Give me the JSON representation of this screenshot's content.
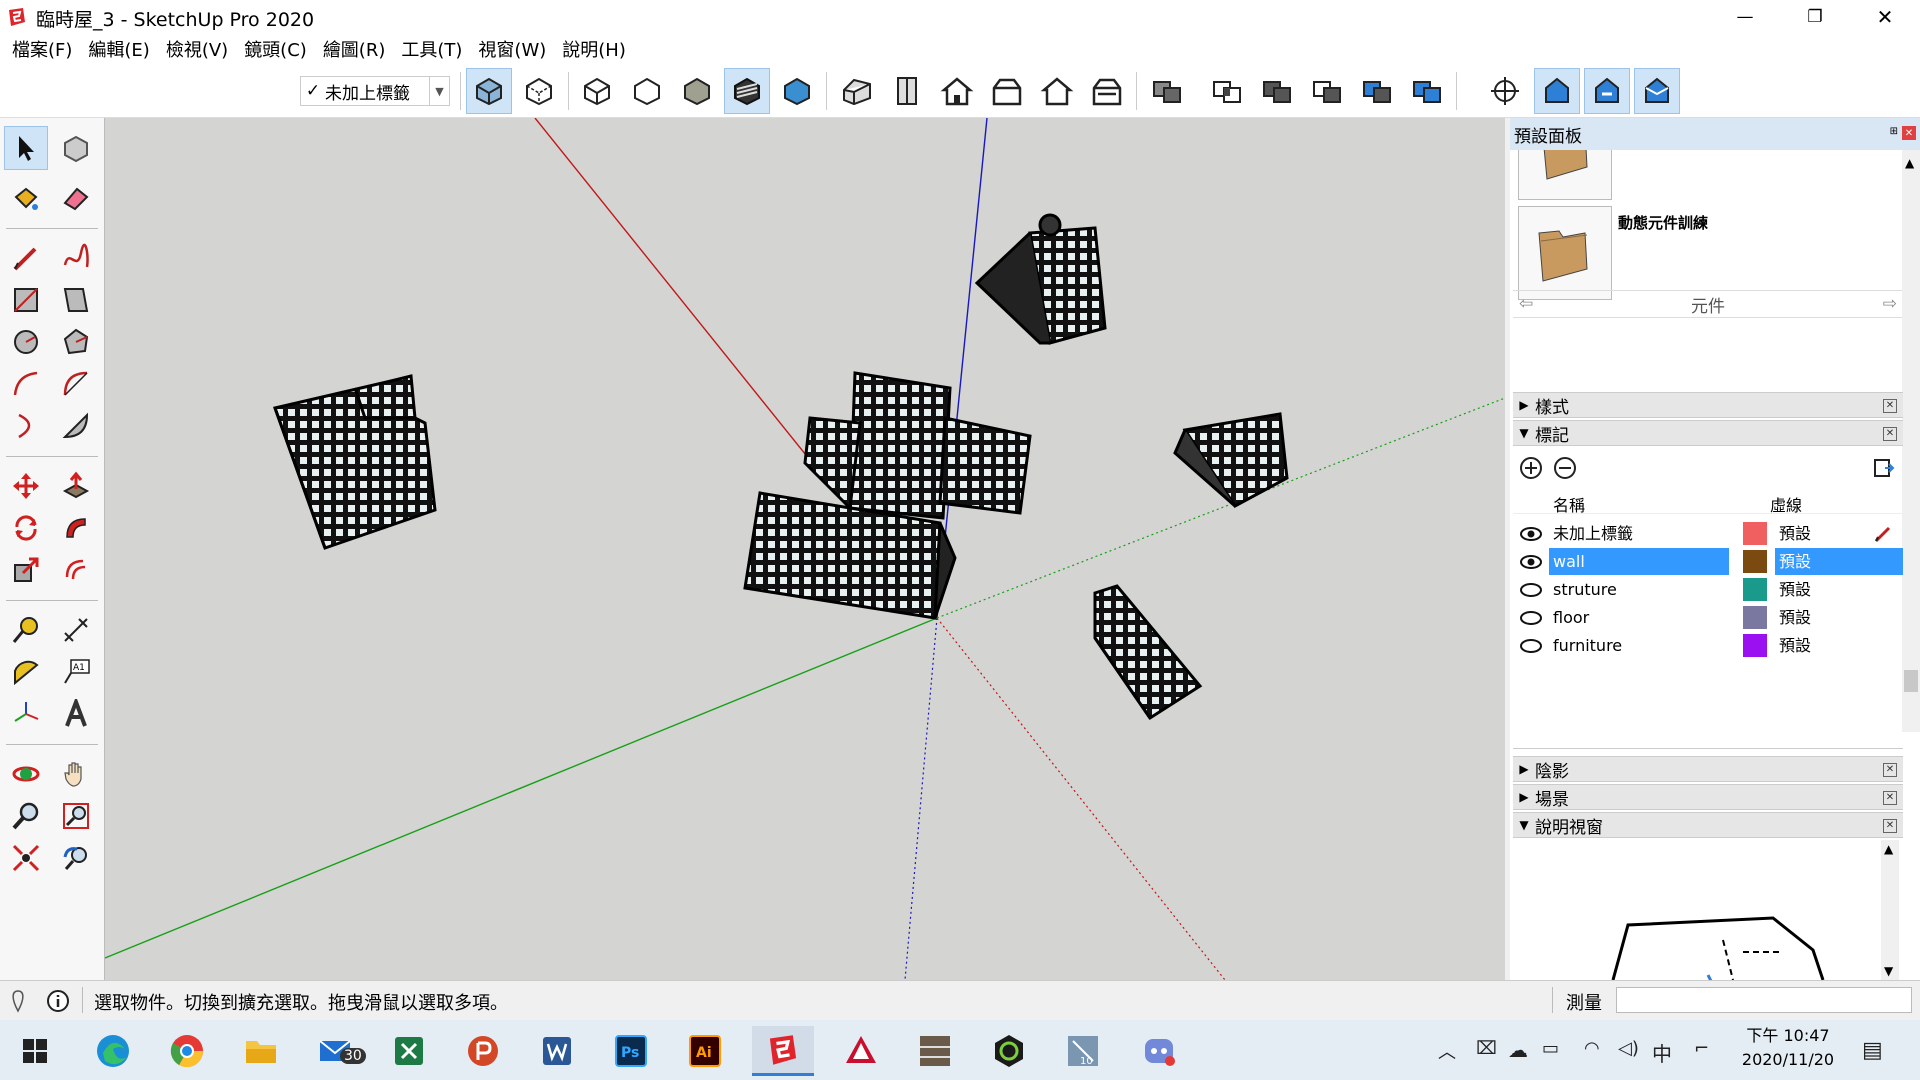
{
  "window": {
    "title": "臨時屋_3 - SketchUp Pro 2020",
    "min": "—",
    "max": "❐",
    "close": "✕"
  },
  "menu": [
    "檔案(F)",
    "編輯(E)",
    "檢視(V)",
    "鏡頭(C)",
    "繪圖(R)",
    "工具(T)",
    "視窗(W)",
    "說明(H)"
  ],
  "toolbar": {
    "tag_check": "✓",
    "tag_value": "未加上標籤"
  },
  "panel": {
    "title": "預設面板",
    "component_label": "動態元件訓練",
    "nav_label": "元件",
    "sections": {
      "styles": "樣式",
      "tags": "標記",
      "shadows": "陰影",
      "scenes": "場景",
      "instructor": "說明視窗"
    },
    "tags_header": {
      "name": "名稱",
      "dashes": "虛線"
    },
    "tags": [
      {
        "name": "未加上標籤",
        "color": "#f06060",
        "dashes": "預設",
        "visible": true,
        "selected": false,
        "active": true
      },
      {
        "name": "wall",
        "color": "#7a4a10",
        "dashes": "預設",
        "visible": true,
        "selected": true,
        "active": false
      },
      {
        "name": "struture",
        "color": "#1a9a8a",
        "dashes": "預設",
        "visible": false,
        "selected": false,
        "active": false
      },
      {
        "name": "floor",
        "color": "#7a78a0",
        "dashes": "預設",
        "visible": false,
        "selected": false,
        "active": false
      },
      {
        "name": "furniture",
        "color": "#9b10f0",
        "dashes": "預設",
        "visible": false,
        "selected": false,
        "active": false
      }
    ]
  },
  "status": {
    "message": "選取物件。切換到擴充選取。拖曳滑鼠以選取多項。",
    "measure_label": "測量",
    "measure_value": ""
  },
  "taskbar": {
    "mail_badge": "30",
    "ime": "中",
    "time": "下午 10:47",
    "date": "2020/11/20"
  }
}
